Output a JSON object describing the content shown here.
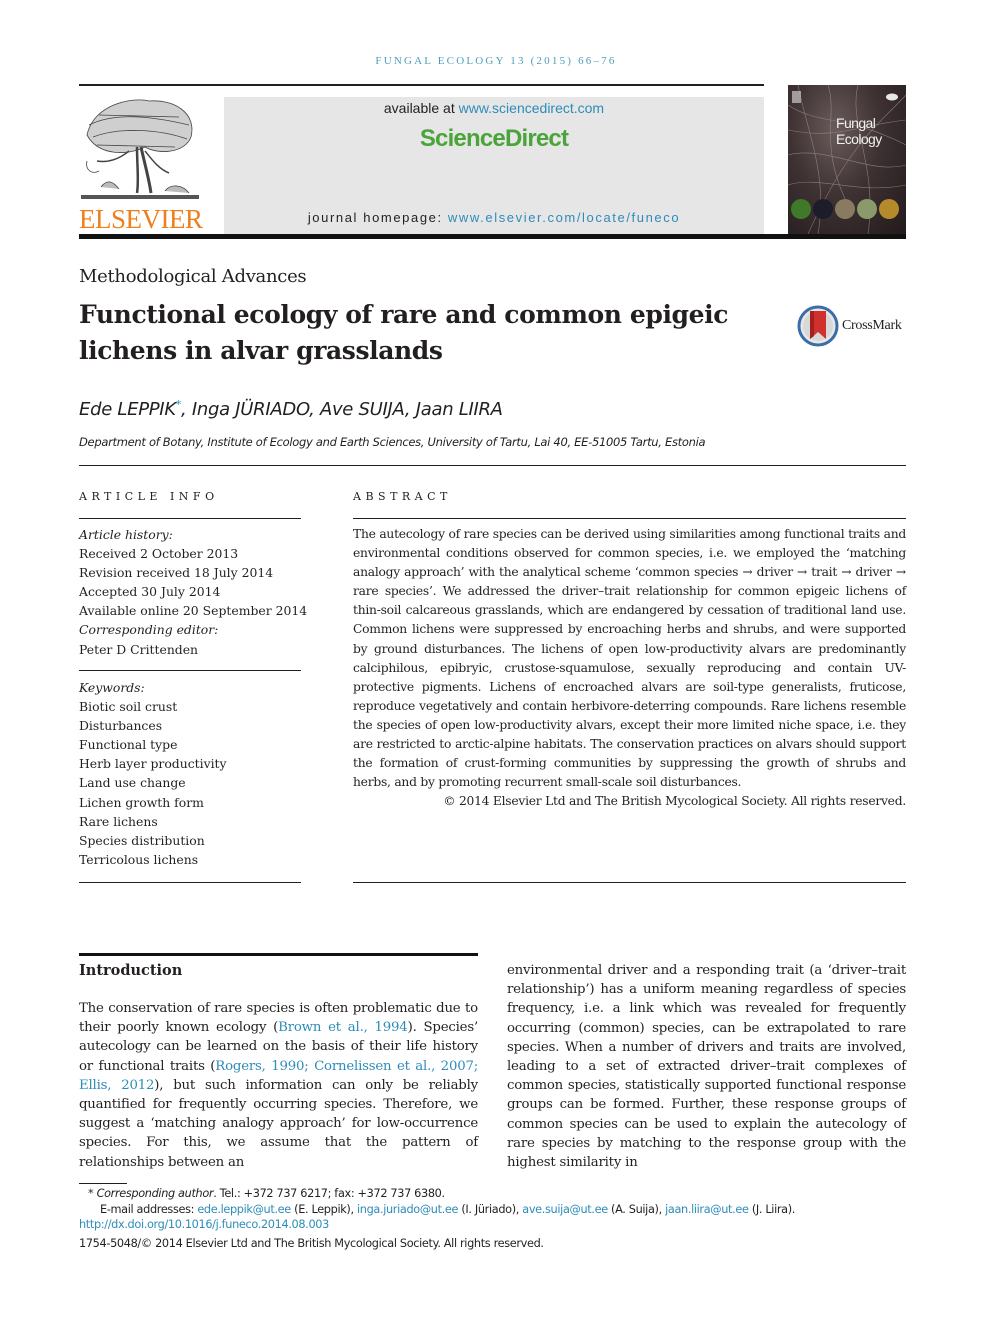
{
  "header": {
    "journal_citation": "FUNGAL ECOLOGY 13 (2015) 66–76",
    "publisher_logo_text": "ELSEVIER",
    "available_prefix": "available at ",
    "available_link": "www.sciencedirect.com",
    "platform_name": "ScienceDirect",
    "homepage_prefix": "journal homepage: ",
    "homepage_link": "www.elsevier.com/locate/funeco",
    "cover_title_line1": "Fungal",
    "cover_title_line2": "Ecology"
  },
  "article": {
    "section_type": "Methodological Advances",
    "title_line1": "Functional ecology of rare and common epigeic",
    "title_line2": "lichens in alvar grasslands",
    "crossmark_label": "CrossMark",
    "authors": [
      {
        "name": "Ede LEPPIK",
        "mark": "*",
        "sep": ", "
      },
      {
        "name": "Inga JÜRIADO",
        "mark": "",
        "sep": ", "
      },
      {
        "name": "Ave SUIJA",
        "mark": "",
        "sep": ", "
      },
      {
        "name": "Jaan LIIRA",
        "mark": "",
        "sep": ""
      }
    ],
    "affiliation": "Department of Botany, Institute of Ecology and Earth Sciences, University of Tartu, Lai 40, EE-51005 Tartu, Estonia"
  },
  "article_info": {
    "heading": "ARTICLE INFO",
    "history_label": "Article history:",
    "received": "Received 2 October 2013",
    "revision": "Revision received 18 July 2014",
    "accepted": "Accepted 30 July 2014",
    "online": "Available online 20 September 2014",
    "editor_label": "Corresponding editor:",
    "editor": "Peter D Crittenden",
    "keywords_label": "Keywords:",
    "keywords": [
      "Biotic soil crust",
      "Disturbances",
      "Functional type",
      "Herb layer productivity",
      "Land use change",
      "Lichen growth form",
      "Rare lichens",
      "Species distribution",
      "Terricolous lichens"
    ]
  },
  "abstract": {
    "heading": "ABSTRACT",
    "body": "The autecology of rare species can be derived using similarities among functional traits and environmental conditions observed for common species, i.e. we employed the ‘matching analogy approach’ with the analytical scheme ‘common species → driver → trait → driver → rare species’. We addressed the driver–trait relationship for common epigeic lichens of thin-soil calcareous grasslands, which are endangered by cessation of traditional land use. Common lichens were suppressed by encroaching herbs and shrubs, and were supported by ground disturbances. The lichens of open low-productivity alvars are predominantly calci­philous, epibryic, crustose-squamulose, sexually reproducing and contain UV-protective pig­ments. Lichens of encroached alvars are soil-type generalists, fruticose, reproduce vegetatively and contain herbivore-deterring compounds. Rare lichens resemble the species of open low-productivity alvars, except their more limited niche space, i.e. they are restricted to arctic-alpine habitats. The conservation practices on alvars should support the formation of crust-forming communities by suppressing the growth of shrubs and herbs, and by promoting recurrent small-scale soil disturbances.",
    "copyright": "© 2014 Elsevier Ltd and The British Mycological Society. All rights reserved."
  },
  "introduction": {
    "heading": "Introduction",
    "left_p1": "The conservation of rare species is often problematic due to their poorly known ecology (",
    "cite1": "Brown et al., 1994",
    "left_p2": "). Species’ autecology can be learned on the basis of their life history or functional traits (",
    "cite2": "Rogers, 1990; Cornelissen et al., 2007; Ellis, 2012",
    "left_p3": "), but such information can only be reliably quantified for frequently occurring species. Therefore, we suggest a ‘matching analogy approach’ for low-occurrence species. For this, we assume that the pattern of relationships between an",
    "right_text": "environmental driver and a responding trait (a ‘driver–trait relationship’) has a uniform meaning regardless of species frequency, i.e. a link which was revealed for frequently occurring (common) species, can be extrapolated to rare spe­cies. When a number of drivers and traits are involved, leading to a set of extracted driver–trait complexes of common spe­cies, statistically supported functional response groups can be formed. Further, these response groups of common species can be used to explain the autecology of rare species by matching to the response group with the highest similarity in"
  },
  "footnotes": {
    "star": "*",
    "corr_label": "Corresponding author",
    "corr_contact": ". Tel.: +372 737 6217; fax: +372 737 6380.",
    "email_label": "E-mail addresses: ",
    "emails": [
      {
        "email": "ede.leppik@ut.ee",
        "who": " (E. Leppik), "
      },
      {
        "email": "inga.juriado@ut.ee",
        "who": " (I. Jüriado), "
      },
      {
        "email": "ave.suija@ut.ee",
        "who": " (A. Suija), "
      },
      {
        "email": "jaan.liira@ut.ee",
        "who": " (J. Liira)."
      }
    ],
    "doi": "http://dx.doi.org/10.1016/j.funeco.2014.08.003",
    "issn_copyright": "1754-5048/© 2014 Elsevier Ltd and The British Mycological Society. All rights reserved."
  }
}
